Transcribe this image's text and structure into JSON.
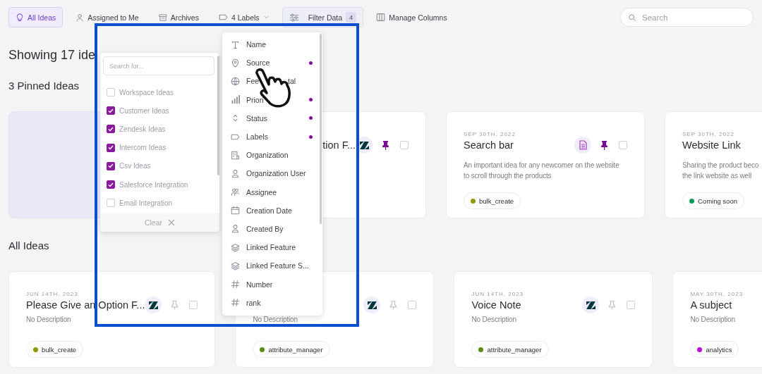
{
  "toolbar": {
    "tabs": [
      {
        "label": "All Ideas",
        "selected": true
      },
      {
        "label": "Assigned to Me",
        "selected": false
      },
      {
        "label": "Archives",
        "selected": false
      }
    ],
    "labels_dropdown": {
      "label": "4 Labels"
    },
    "filter_button": {
      "label": "Filter Data",
      "badge": "4",
      "open": true
    },
    "columns_button": {
      "label": "Manage Columns"
    },
    "search": {
      "placeholder": "Search"
    }
  },
  "heading": "Showing 17 ide",
  "pinned_heading": "3 Pinned Ideas",
  "pinned_cards": [
    {
      "kind": "blank"
    },
    {
      "kind": "idea_cut_left",
      "title": "tion F...",
      "source_icon": {
        "kind": "zendesk"
      },
      "pinned": true,
      "checked": false
    },
    {
      "kind": "idea",
      "date": "SEP 30TH, 2022",
      "title": "Search bar",
      "source_icon": {
        "kind": "document"
      },
      "pinned": true,
      "checked": false,
      "description_lines": [
        "An important idea for any newcomer on the website",
        "to scroll through the products"
      ],
      "tag": {
        "label": "bulk_create",
        "color": "#8f9a00"
      }
    },
    {
      "kind": "idea",
      "date": "SEP 30TH, 2022",
      "title": "Website Link",
      "description_lines": [
        "Sharing the product beco",
        "the link website as well"
      ],
      "tag": {
        "label": "Coming soon",
        "color": "#11995a"
      }
    }
  ],
  "all_heading": "All Ideas",
  "all_cards": [
    {
      "kind": "idea",
      "date": "JUN 14TH, 2023",
      "title": "Please Give an Option F...",
      "source_icon": {
        "kind": "zendesk"
      },
      "pinned": false,
      "checked": false,
      "description_lines": [
        "No Description"
      ],
      "tag": {
        "label": "bulk_create",
        "color": "#8f9a00"
      }
    },
    {
      "kind": "idea",
      "source_icon": {
        "kind": "zendesk"
      },
      "pinned": false,
      "checked": false,
      "description_lines": [
        "No Description"
      ],
      "tag": {
        "label": "attribute_manager",
        "color": "#5c8a12"
      }
    },
    {
      "kind": "idea",
      "date": "JUN 14TH, 2023",
      "title": "Voice Note",
      "source_icon": {
        "kind": "zendesk"
      },
      "pinned": false,
      "checked": false,
      "description_lines": [
        "No Description"
      ],
      "tag": {
        "label": "attribute_manager",
        "color": "#5c8a12"
      }
    },
    {
      "kind": "idea",
      "date": "MAY 30TH, 2023",
      "title": "A subject",
      "description_lines": [
        "No Description"
      ],
      "tag": {
        "label": "analytics",
        "color": "#b80fd6"
      }
    }
  ],
  "source_menu": {
    "search": {
      "placeholder": "Search for..."
    },
    "options": [
      {
        "label": "Workspace Ideas",
        "checked": false
      },
      {
        "label": "Customer Ideas",
        "checked": true
      },
      {
        "label": "Zendesk Ideas",
        "checked": true
      },
      {
        "label": "Intercom Ideas",
        "checked": true
      },
      {
        "label": "Csv Ideas",
        "checked": true
      },
      {
        "label": "Salesforce Integration",
        "checked": true
      },
      {
        "label": "Email Integration",
        "checked": false
      }
    ],
    "clear": "Clear"
  },
  "field_menu": [
    {
      "label": "Name",
      "filtered": false
    },
    {
      "label": "Source",
      "filtered": true
    },
    {
      "label": "Fee",
      "label_end": "tal",
      "filtered": false
    },
    {
      "label": "Priori",
      "filtered": true
    },
    {
      "label": "Status",
      "filtered": true
    },
    {
      "label": "Labels",
      "filtered": true
    },
    {
      "label": "Organization",
      "filtered": false
    },
    {
      "label": "Organization User",
      "filtered": false
    },
    {
      "label": "Assignee",
      "filtered": false
    },
    {
      "label": "Creation Date",
      "filtered": false
    },
    {
      "label": "Created By",
      "filtered": false
    },
    {
      "label": "Linked Feature",
      "filtered": false
    },
    {
      "label": "Linked Feature S...",
      "filtered": false
    },
    {
      "label": "Number",
      "filtered": false
    },
    {
      "label": "rank",
      "filtered": false
    }
  ]
}
